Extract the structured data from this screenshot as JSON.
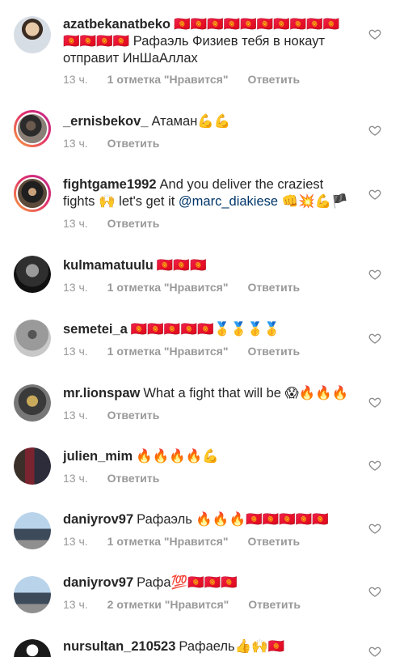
{
  "comments": [
    {
      "username": "azatbekanatbeko",
      "text": "🇰🇬🇰🇬🇰🇬🇰🇬🇰🇬🇰🇬🇰🇬🇰🇬🇰🇬🇰🇬🇰🇬🇰🇬🇰🇬🇰🇬 Рафаэль Физиев тебя в нокаут отправит ИнШаАллах",
      "time": "13 ч.",
      "likes": "1 отметка \"Нравится\"",
      "reply": "Ответить"
    },
    {
      "username": "_ernisbekov_",
      "text": "Атаман💪💪",
      "time": "13 ч.",
      "likes": "",
      "reply": "Ответить"
    },
    {
      "username": "fightgame1992",
      "text": "And you deliver the craziest fights 🙌 let's get it ",
      "mention": "@marc_diakiese",
      "text_after": " 👊💥💪🏴",
      "time": "13 ч.",
      "likes": "",
      "reply": "Ответить"
    },
    {
      "username": "kulmamatuulu",
      "text": "🇰🇬🇰🇬🇰🇬",
      "time": "13 ч.",
      "likes": "1 отметка \"Нравится\"",
      "reply": "Ответить"
    },
    {
      "username": "semetei_a",
      "text": "🇰🇬🇰🇬🇰🇬🇰🇬🇰🇬🥇🥇🥇🥇",
      "time": "13 ч.",
      "likes": "1 отметка \"Нравится\"",
      "reply": "Ответить"
    },
    {
      "username": "mr.lionspaw",
      "text": "What a fight that will be 😱🔥🔥🔥",
      "time": "13 ч.",
      "likes": "",
      "reply": "Ответить"
    },
    {
      "username": "julien_mim",
      "text": "🔥🔥🔥🔥💪",
      "time": "13 ч.",
      "likes": "",
      "reply": "Ответить"
    },
    {
      "username": "daniyrov97",
      "text": "Рафаэль 🔥🔥🔥🇰🇬🇰🇬🇰🇬🇰🇬🇰🇬",
      "time": "13 ч.",
      "likes": "1 отметка \"Нравится\"",
      "reply": "Ответить"
    },
    {
      "username": "daniyrov97",
      "text": "Рафа💯🇰🇬🇰🇬🇰🇬",
      "time": "13 ч.",
      "likes": "2 отметки \"Нравится\"",
      "reply": "Ответить"
    },
    {
      "username": "nursultan_210523",
      "text": "Рафаель👍🙌🇰🇬",
      "time": "",
      "likes": "",
      "reply": ""
    }
  ],
  "icons": {
    "heart": "heart-outline-icon"
  },
  "colors": {
    "text": "#262626",
    "meta": "#999999",
    "heart_stroke": "#8e8e8e",
    "story_ring_start": "#f9a13a",
    "story_ring_end": "#bc2a8d"
  }
}
